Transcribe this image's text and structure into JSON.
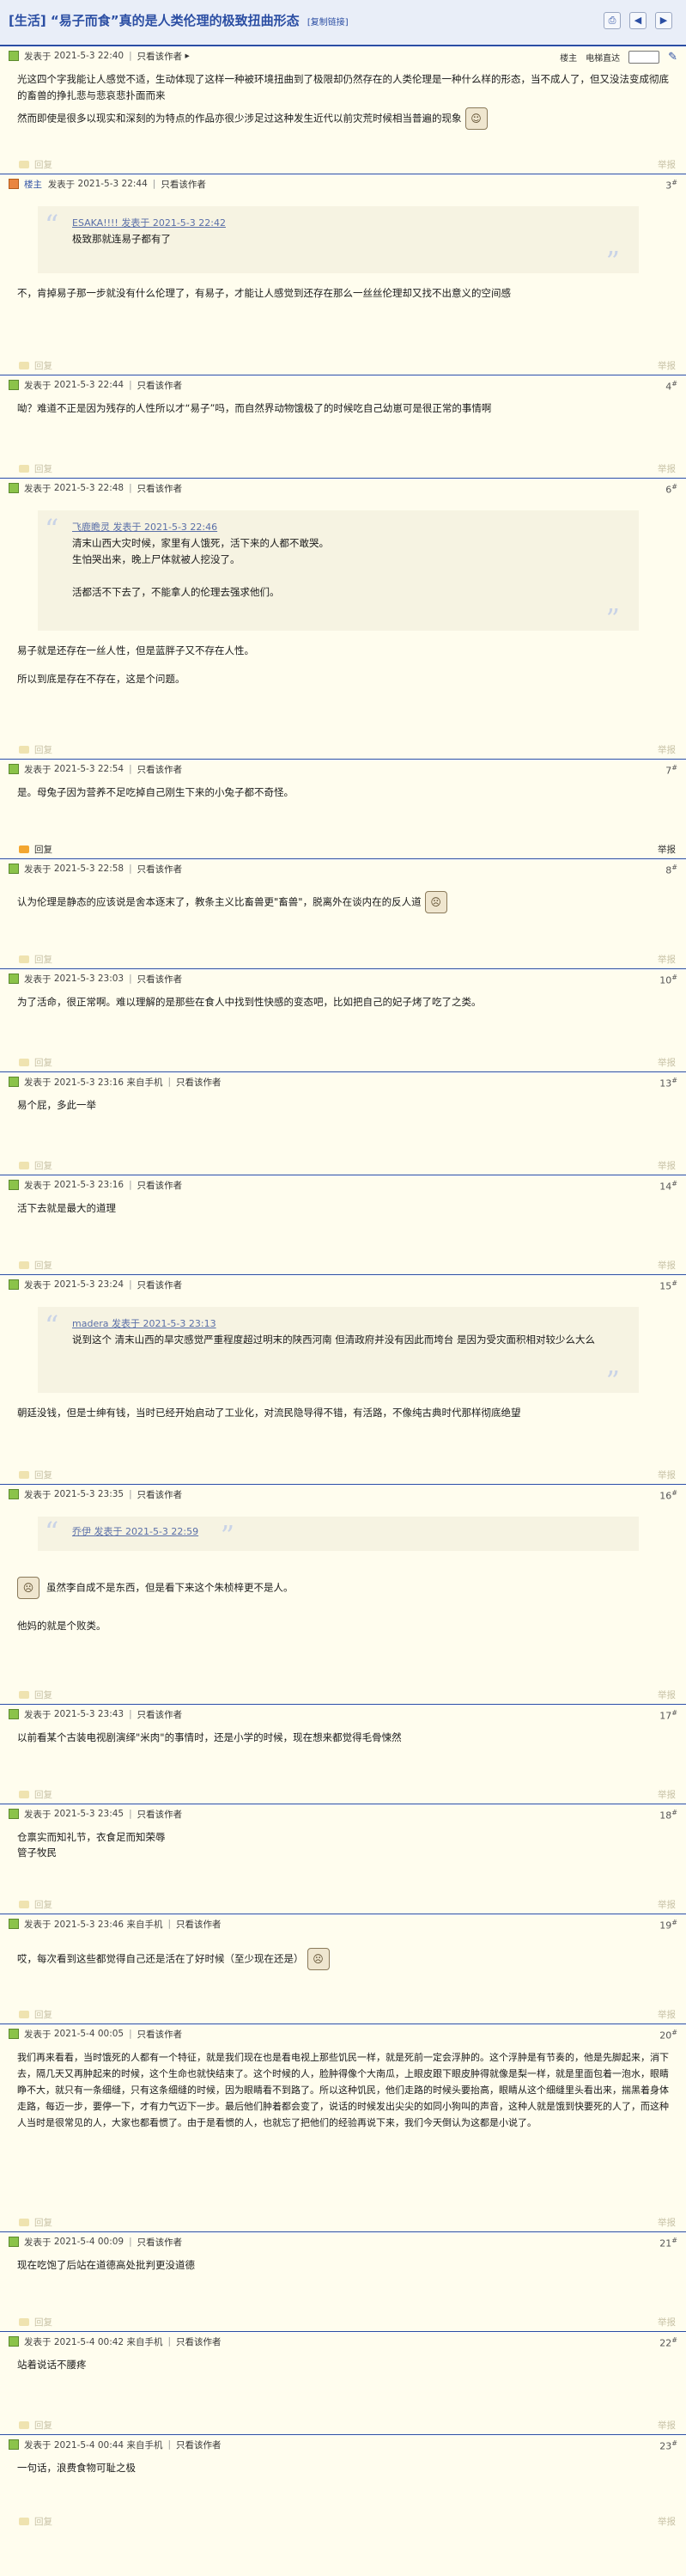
{
  "thread": {
    "title": "[生活] “易子而食”真的是人类伦理的极致扭曲形态",
    "copy_link": "[复制链接]"
  },
  "labels": {
    "reply": "回复",
    "report": "举报",
    "only_author": "只看该作者",
    "posted_prefix": "发表于",
    "owner": "楼主",
    "next_page": "电梯直达",
    "mobile_suffix": "来自手机"
  },
  "posts": [
    {
      "floor": "",
      "date": "2021-5-3 22:40",
      "body": [
        "光这四个字我能让人感觉不适，生动体现了这样一种被环境扭曲到了极限却仍然存在的人类伦理是一种什么样的形态，当不成人了，但又没法变成彻底的畜兽的挣扎悲与悲哀悲扑面而来",
        "然而即使是很多以现实和深刻的为特点的作品亦很少涉足过这种发生近代以前灾荒时候相当普遍的现象"
      ]
    },
    {
      "floor": "3",
      "date": "2021-5-3 22:44",
      "author": "楼主",
      "quote_author": "ESAKA!!!! 发表于 2021-5-3 22:42",
      "quote": [
        "极致那就连易子都有了"
      ],
      "body": [
        "不，肯掉易子那一步就没有什么伦理了，有易子，才能让人感觉到还存在那么一丝丝伦理却又找不出意义的空间感"
      ]
    },
    {
      "floor": "4",
      "date": "2021-5-3 22:44",
      "body": [
        "呦？难道不正是因为残存的人性所以才“易子”吗，而自然界动物饿极了的时候吃自己幼崽可是很正常的事情啊"
      ]
    },
    {
      "floor": "6",
      "date": "2021-5-3 22:48",
      "quote_author": "飞鹿瞻灵 发表于 2021-5-3 22:46",
      "quote": [
        "清末山西大灾时候，家里有人饿死，活下来的人都不敢哭。",
        "生怕哭出来，晚上尸体就被人挖没了。",
        "",
        "活都活不下去了，不能拿人的伦理去强求他们。"
      ],
      "body": [
        "易子就是还存在一丝人性，但是蓝胖子又不存在人性。",
        "所以到底是存在不存在，这是个问题。"
      ]
    },
    {
      "floor": "7",
      "date": "2021-5-3 22:54",
      "body": [
        "是。母兔子因为营养不足吃掉自己刚生下来的小兔子都不奇怪。"
      ]
    },
    {
      "floor": "8",
      "date": "2021-5-3 22:58",
      "body": [
        "认为伦理是静态的应该说是舍本逐末了，教条主义比畜兽更\"畜兽\"，脱离外在谈内在的反人道"
      ]
    },
    {
      "floor": "10",
      "date": "2021-5-3 23:03",
      "body": [
        "为了活命，很正常啊。难以理解的是那些在食人中找到性快感的变态吧，比如把自己的妃子烤了吃了之类。"
      ]
    },
    {
      "floor": "13",
      "date": "2021-5-3 23:16 来自手机",
      "body": [
        "易个屁，多此一举"
      ]
    },
    {
      "floor": "14",
      "date": "2021-5-3 23:16",
      "body": [
        "活下去就是最大的道理"
      ]
    },
    {
      "floor": "15",
      "date": "2021-5-3 23:24",
      "quote_author": "madera 发表于 2021-5-3 23:13",
      "quote": [
        "说到这个 清末山西的旱灾感觉严重程度超过明末的陕西河南 但清政府并没有因此而垮台 是因为受灾面积相对较少么大么"
      ],
      "body": [
        "朝廷没钱，但是士绅有钱，当时已经开始启动了工业化，对流民隐导得不错，有活路，不像纯古典时代那样彻底绝望"
      ]
    },
    {
      "floor": "16",
      "date": "2021-5-3 23:35",
      "quote_author": "乔伊 发表于 2021-5-3 22:59",
      "quote": [],
      "body": [
        "虽然李自成不是东西，但是看下来这个朱桢梓更不是人。",
        "他妈的就是个败类。"
      ]
    },
    {
      "floor": "17",
      "date": "2021-5-3 23:43",
      "body": [
        "以前看某个古装电视剧演绎\"米肉\"的事情时，还是小学的时候，现在想来都觉得毛骨悚然"
      ]
    },
    {
      "floor": "18",
      "date": "2021-5-3 23:45",
      "body": [
        "仓禀实而知礼节，衣食足而知荣辱",
        "管子牧民"
      ]
    },
    {
      "floor": "19",
      "date": "2021-5-3 23:46 来自手机",
      "body": [
        "哎，每次看到这些都觉得自己还是活在了好时候（至少现在还是）"
      ]
    },
    {
      "floor": "20",
      "date": "2021-5-4 00:05",
      "body": [
        "我们再来看看，当时饿死的人都有一个特征，就是我们现在也是看电视上那些饥民一样，就是死前一定会浮肿的。这个浮肿是有节奏的，他是先脚起来，消下去，隔几天又再肿起来的时候，这个生命也就快结束了。这个时候的人，脸肿得像个大南瓜，上眼皮跟下眼皮肿得就像是梨一样，就是里面包着一泡水，眼睛睁不大，就只有一条细缝，只有这条细缝的时候，因为眼睛看不到路了。所以这种饥民，他们走路的时候头要抬高，眼睛从这个细缝里头看出来，揣黑着身体走路，每迈一步，要停一下，才有力气迈下一步。最后他们肿着都会变了，说话的时候发出尖尖的如同小狗叫的声音，这种人就是饿到快要死的人了，而这种人当时是很常见的人，大家也都看惯了。由于是看惯的人，也就忘了把他们的经验再说下来，我们今天倒认为这都是小说了。"
      ]
    },
    {
      "floor": "21",
      "date": "2021-5-4 00:09",
      "body": [
        "现在吃饱了后站在道德高处批判更没道德"
      ]
    },
    {
      "floor": "22",
      "date": "2021-5-4 00:42 来自手机",
      "body": [
        "站着说话不腰疼"
      ]
    },
    {
      "floor": "23",
      "date": "2021-5-4 00:44 来自手机",
      "body": [
        "一句话，浪费食物可耻之极"
      ]
    }
  ]
}
